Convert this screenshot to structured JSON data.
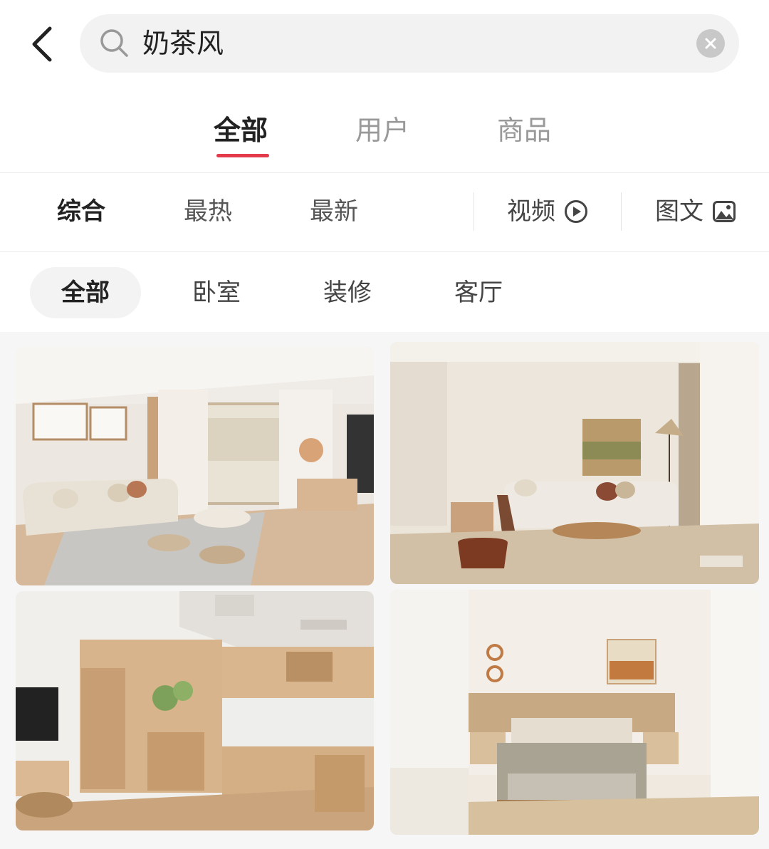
{
  "search": {
    "query": "奶茶风"
  },
  "main_tabs": [
    {
      "label": "全部",
      "active": true
    },
    {
      "label": "用户",
      "active": false
    },
    {
      "label": "商品",
      "active": false
    }
  ],
  "sort_options": [
    {
      "label": "综合",
      "active": true
    },
    {
      "label": "最热",
      "active": false
    },
    {
      "label": "最新",
      "active": false
    }
  ],
  "filters": {
    "video_label": "视频",
    "image_text_label": "图文"
  },
  "chips": [
    {
      "label": "全部",
      "active": true
    },
    {
      "label": "卧室",
      "active": false
    },
    {
      "label": "装修",
      "active": false
    },
    {
      "label": "客厅",
      "active": false
    }
  ],
  "feed": {
    "cards": [
      {
        "scene": "living-room-gray-rug"
      },
      {
        "scene": "kitchen-wood-cabinets"
      },
      {
        "scene": "living-room-abstract-art"
      },
      {
        "scene": "bedroom-wood-headboard"
      }
    ]
  },
  "colors": {
    "accent": "#e33b4b",
    "search_bg": "#f2f2f2",
    "chip_active_bg": "#f3f3f3"
  }
}
